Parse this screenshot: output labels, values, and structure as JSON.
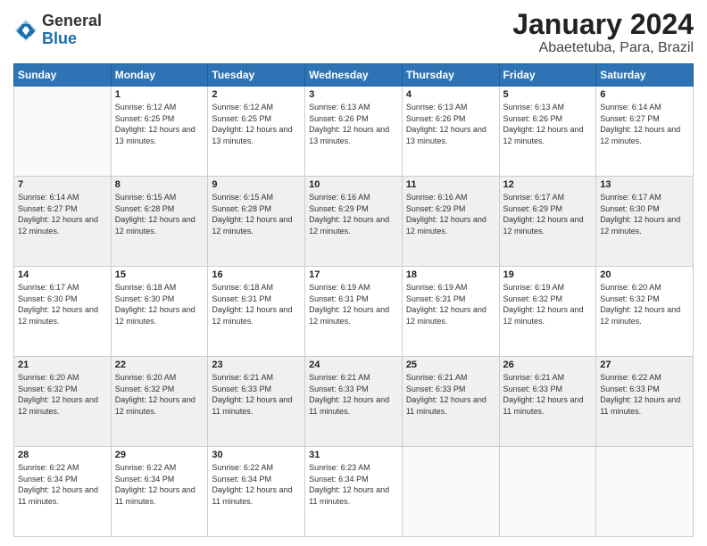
{
  "header": {
    "logo_general": "General",
    "logo_blue": "Blue",
    "title": "January 2024",
    "subtitle": "Abaetetuba, Para, Brazil"
  },
  "days_of_week": [
    "Sunday",
    "Monday",
    "Tuesday",
    "Wednesday",
    "Thursday",
    "Friday",
    "Saturday"
  ],
  "weeks": [
    [
      {
        "day": "",
        "sunrise": "",
        "sunset": "",
        "daylight": ""
      },
      {
        "day": "1",
        "sunrise": "Sunrise: 6:12 AM",
        "sunset": "Sunset: 6:25 PM",
        "daylight": "Daylight: 12 hours and 13 minutes."
      },
      {
        "day": "2",
        "sunrise": "Sunrise: 6:12 AM",
        "sunset": "Sunset: 6:25 PM",
        "daylight": "Daylight: 12 hours and 13 minutes."
      },
      {
        "day": "3",
        "sunrise": "Sunrise: 6:13 AM",
        "sunset": "Sunset: 6:26 PM",
        "daylight": "Daylight: 12 hours and 13 minutes."
      },
      {
        "day": "4",
        "sunrise": "Sunrise: 6:13 AM",
        "sunset": "Sunset: 6:26 PM",
        "daylight": "Daylight: 12 hours and 13 minutes."
      },
      {
        "day": "5",
        "sunrise": "Sunrise: 6:13 AM",
        "sunset": "Sunset: 6:26 PM",
        "daylight": "Daylight: 12 hours and 12 minutes."
      },
      {
        "day": "6",
        "sunrise": "Sunrise: 6:14 AM",
        "sunset": "Sunset: 6:27 PM",
        "daylight": "Daylight: 12 hours and 12 minutes."
      }
    ],
    [
      {
        "day": "7",
        "sunrise": "Sunrise: 6:14 AM",
        "sunset": "Sunset: 6:27 PM",
        "daylight": "Daylight: 12 hours and 12 minutes."
      },
      {
        "day": "8",
        "sunrise": "Sunrise: 6:15 AM",
        "sunset": "Sunset: 6:28 PM",
        "daylight": "Daylight: 12 hours and 12 minutes."
      },
      {
        "day": "9",
        "sunrise": "Sunrise: 6:15 AM",
        "sunset": "Sunset: 6:28 PM",
        "daylight": "Daylight: 12 hours and 12 minutes."
      },
      {
        "day": "10",
        "sunrise": "Sunrise: 6:16 AM",
        "sunset": "Sunset: 6:29 PM",
        "daylight": "Daylight: 12 hours and 12 minutes."
      },
      {
        "day": "11",
        "sunrise": "Sunrise: 6:16 AM",
        "sunset": "Sunset: 6:29 PM",
        "daylight": "Daylight: 12 hours and 12 minutes."
      },
      {
        "day": "12",
        "sunrise": "Sunrise: 6:17 AM",
        "sunset": "Sunset: 6:29 PM",
        "daylight": "Daylight: 12 hours and 12 minutes."
      },
      {
        "day": "13",
        "sunrise": "Sunrise: 6:17 AM",
        "sunset": "Sunset: 6:30 PM",
        "daylight": "Daylight: 12 hours and 12 minutes."
      }
    ],
    [
      {
        "day": "14",
        "sunrise": "Sunrise: 6:17 AM",
        "sunset": "Sunset: 6:30 PM",
        "daylight": "Daylight: 12 hours and 12 minutes."
      },
      {
        "day": "15",
        "sunrise": "Sunrise: 6:18 AM",
        "sunset": "Sunset: 6:30 PM",
        "daylight": "Daylight: 12 hours and 12 minutes."
      },
      {
        "day": "16",
        "sunrise": "Sunrise: 6:18 AM",
        "sunset": "Sunset: 6:31 PM",
        "daylight": "Daylight: 12 hours and 12 minutes."
      },
      {
        "day": "17",
        "sunrise": "Sunrise: 6:19 AM",
        "sunset": "Sunset: 6:31 PM",
        "daylight": "Daylight: 12 hours and 12 minutes."
      },
      {
        "day": "18",
        "sunrise": "Sunrise: 6:19 AM",
        "sunset": "Sunset: 6:31 PM",
        "daylight": "Daylight: 12 hours and 12 minutes."
      },
      {
        "day": "19",
        "sunrise": "Sunrise: 6:19 AM",
        "sunset": "Sunset: 6:32 PM",
        "daylight": "Daylight: 12 hours and 12 minutes."
      },
      {
        "day": "20",
        "sunrise": "Sunrise: 6:20 AM",
        "sunset": "Sunset: 6:32 PM",
        "daylight": "Daylight: 12 hours and 12 minutes."
      }
    ],
    [
      {
        "day": "21",
        "sunrise": "Sunrise: 6:20 AM",
        "sunset": "Sunset: 6:32 PM",
        "daylight": "Daylight: 12 hours and 12 minutes."
      },
      {
        "day": "22",
        "sunrise": "Sunrise: 6:20 AM",
        "sunset": "Sunset: 6:32 PM",
        "daylight": "Daylight: 12 hours and 12 minutes."
      },
      {
        "day": "23",
        "sunrise": "Sunrise: 6:21 AM",
        "sunset": "Sunset: 6:33 PM",
        "daylight": "Daylight: 12 hours and 11 minutes."
      },
      {
        "day": "24",
        "sunrise": "Sunrise: 6:21 AM",
        "sunset": "Sunset: 6:33 PM",
        "daylight": "Daylight: 12 hours and 11 minutes."
      },
      {
        "day": "25",
        "sunrise": "Sunrise: 6:21 AM",
        "sunset": "Sunset: 6:33 PM",
        "daylight": "Daylight: 12 hours and 11 minutes."
      },
      {
        "day": "26",
        "sunrise": "Sunrise: 6:21 AM",
        "sunset": "Sunset: 6:33 PM",
        "daylight": "Daylight: 12 hours and 11 minutes."
      },
      {
        "day": "27",
        "sunrise": "Sunrise: 6:22 AM",
        "sunset": "Sunset: 6:33 PM",
        "daylight": "Daylight: 12 hours and 11 minutes."
      }
    ],
    [
      {
        "day": "28",
        "sunrise": "Sunrise: 6:22 AM",
        "sunset": "Sunset: 6:34 PM",
        "daylight": "Daylight: 12 hours and 11 minutes."
      },
      {
        "day": "29",
        "sunrise": "Sunrise: 6:22 AM",
        "sunset": "Sunset: 6:34 PM",
        "daylight": "Daylight: 12 hours and 11 minutes."
      },
      {
        "day": "30",
        "sunrise": "Sunrise: 6:22 AM",
        "sunset": "Sunset: 6:34 PM",
        "daylight": "Daylight: 12 hours and 11 minutes."
      },
      {
        "day": "31",
        "sunrise": "Sunrise: 6:23 AM",
        "sunset": "Sunset: 6:34 PM",
        "daylight": "Daylight: 12 hours and 11 minutes."
      },
      {
        "day": "",
        "sunrise": "",
        "sunset": "",
        "daylight": ""
      },
      {
        "day": "",
        "sunrise": "",
        "sunset": "",
        "daylight": ""
      },
      {
        "day": "",
        "sunrise": "",
        "sunset": "",
        "daylight": ""
      }
    ]
  ]
}
